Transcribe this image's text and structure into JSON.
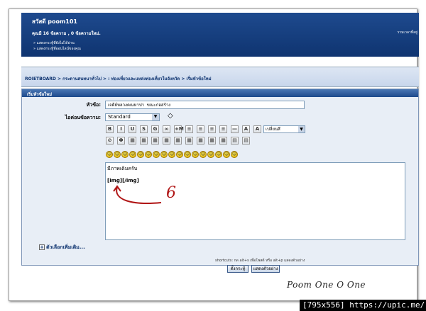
{
  "welcome": {
    "greeting": "สวัสดี poom101",
    "counts": "คุณมี 16 ข้อความ , 0 ข้อความใหม่.",
    "right_text": "รวมเวลาที่อยู่",
    "link1": "» แสดงกระทู้ที่ยังไม่ได้อ่าน",
    "link2": "» แสดงกระทู้ที่ออนไลน์ของคุณ"
  },
  "navbar": {
    "breadcrumb": "ROIETBOARD > กระดานสนทนาทั่วไป > : ท่องเที่ยวและแหล่งท่องเที่ยวในจังหวัด > เริ่มหัวข้อใหม่"
  },
  "panel": {
    "heading": "เริ่มหัวข้อใหม่"
  },
  "form": {
    "title_label": "หัวข้อ:",
    "title_value": "เจดีย์หลวงคณหาปา  ขณะก่อสร้าง",
    "icon_label": "ไอค่อนข้อความ:",
    "icon_value": "Standard",
    "font_value": "เปลี่ยนสี"
  },
  "toolbar": {
    "row1": [
      "B",
      "I",
      "U",
      "S",
      "G",
      "∞",
      "+M",
      "≡",
      "≡",
      "≡",
      "≡",
      "—",
      "A",
      "A"
    ],
    "row2": [
      "⊘",
      "Φ",
      "▦",
      "▦",
      "▦",
      "▦",
      "▦",
      "▦",
      "▦",
      "▦",
      "▦",
      "▤",
      "▤"
    ]
  },
  "smilies": [
    "☺",
    "☺",
    "☺",
    "☺",
    "☺",
    "☺",
    "☺",
    "☺",
    "☺",
    "☺",
    "☺",
    "☺",
    "☺",
    "☺",
    "☺",
    "☺",
    "☺"
  ],
  "editor": {
    "line1": "มีภาพเดิมครับ",
    "line2": "[img][/img]",
    "annotation": "6"
  },
  "options_link": "ตัวเลือกเพิ่มเติม...",
  "shortcuts": "shortcuts: กด alt+s เพื่อโพสต์ หรือ alt+p แสดงตัวอย่าง",
  "buttons": {
    "submit": "ตั้งกระทู้",
    "preview": "แสดงตัวอย่าง"
  },
  "watermark": "Poom One O One",
  "image_host": "[795x556] https://upic.me/"
}
